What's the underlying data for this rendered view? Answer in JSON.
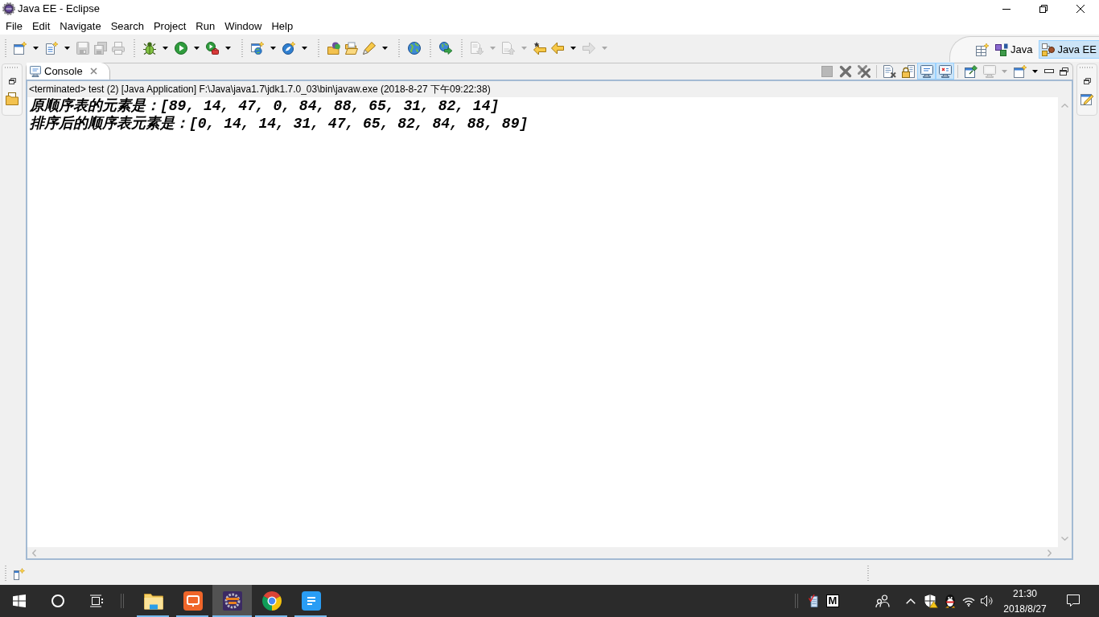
{
  "window": {
    "title": "Java EE - Eclipse"
  },
  "menu_bar": [
    "File",
    "Edit",
    "Navigate",
    "Search",
    "Project",
    "Run",
    "Window",
    "Help"
  ],
  "toolbar": [
    [
      {
        "kind": "new",
        "disabled": false,
        "dropdown": true
      },
      {
        "kind": "new-file",
        "disabled": false,
        "dropdown": true
      },
      {
        "kind": "save",
        "disabled": true,
        "dropdown": false
      },
      {
        "kind": "save-all",
        "disabled": true,
        "dropdown": false
      },
      {
        "kind": "print",
        "disabled": true,
        "dropdown": false
      }
    ],
    [
      {
        "kind": "debug",
        "disabled": false,
        "dropdown": true
      },
      {
        "kind": "run",
        "disabled": false,
        "dropdown": true
      },
      {
        "kind": "external-tools",
        "disabled": false,
        "dropdown": true
      }
    ],
    [
      {
        "kind": "new-server",
        "disabled": false,
        "dropdown": true
      },
      {
        "kind": "new-spring",
        "disabled": false,
        "dropdown": true
      }
    ],
    [
      {
        "kind": "open-type",
        "disabled": false,
        "dropdown": false
      },
      {
        "kind": "open-task",
        "disabled": false,
        "dropdown": false
      },
      {
        "kind": "search",
        "disabled": false,
        "dropdown": true
      }
    ],
    [
      {
        "kind": "browser",
        "disabled": false,
        "dropdown": false
      }
    ],
    [
      {
        "kind": "run-server",
        "disabled": false,
        "dropdown": false
      }
    ],
    [
      {
        "kind": "next-annotation",
        "disabled": true,
        "dropdown": true
      },
      {
        "kind": "prev-annotation",
        "disabled": true,
        "dropdown": true
      },
      {
        "kind": "last-edit",
        "disabled": false,
        "dropdown": false
      },
      {
        "kind": "back",
        "disabled": false,
        "dropdown": true
      },
      {
        "kind": "forward",
        "disabled": true,
        "dropdown": true
      }
    ]
  ],
  "perspectives": [
    {
      "label": "Java",
      "selected": false
    },
    {
      "label": "Java EE",
      "selected": true
    }
  ],
  "console_view": {
    "tabs": [
      {
        "label": "Console",
        "selected": true
      }
    ],
    "toolbar": [
      [
        {
          "kind": "terminate",
          "disabled": true,
          "checked": false,
          "dropdown": false
        },
        {
          "kind": "remove-launch",
          "disabled": false,
          "checked": false,
          "dropdown": false
        },
        {
          "kind": "remove-all",
          "disabled": false,
          "checked": false,
          "dropdown": false
        }
      ],
      [
        {
          "kind": "clear-console",
          "disabled": false,
          "checked": false,
          "dropdown": false
        },
        {
          "kind": "scroll-lock",
          "disabled": false,
          "checked": false,
          "dropdown": false
        },
        {
          "kind": "show-stdout",
          "disabled": false,
          "checked": true,
          "dropdown": false
        },
        {
          "kind": "show-stderr",
          "disabled": false,
          "checked": true,
          "dropdown": false
        }
      ],
      [
        {
          "kind": "pin-console",
          "disabled": false,
          "checked": false,
          "dropdown": false
        },
        {
          "kind": "display-console",
          "disabled": true,
          "checked": false,
          "dropdown": true
        },
        {
          "kind": "open-console",
          "disabled": false,
          "checked": false,
          "dropdown": true
        }
      ]
    ],
    "header": "<terminated> test (2) [Java Application] F:\\Java\\java1.7\\jdk1.7.0_03\\bin\\javaw.exe (2018-8-27 下午09:22:38)",
    "lines": [
      "原顺序表的元素是：[89, 14, 47, 0, 84, 88, 65, 31, 82, 14]",
      "排序后的顺序表元素是：[0, 14, 14, 31, 47, 65, 82, 84, 88, 89]"
    ]
  },
  "taskbar": {
    "apps": [
      {
        "kind": "file-explorer",
        "selected": false,
        "running": true
      },
      {
        "kind": "presentation",
        "selected": false,
        "running": true
      },
      {
        "kind": "eclipse",
        "selected": true,
        "running": true
      },
      {
        "kind": "chrome",
        "selected": false,
        "running": true
      },
      {
        "kind": "writer",
        "selected": false,
        "running": true
      }
    ],
    "tray": {
      "app_tile": "M"
    },
    "clock": {
      "time": "21:30",
      "date": "2018/8/27"
    }
  }
}
